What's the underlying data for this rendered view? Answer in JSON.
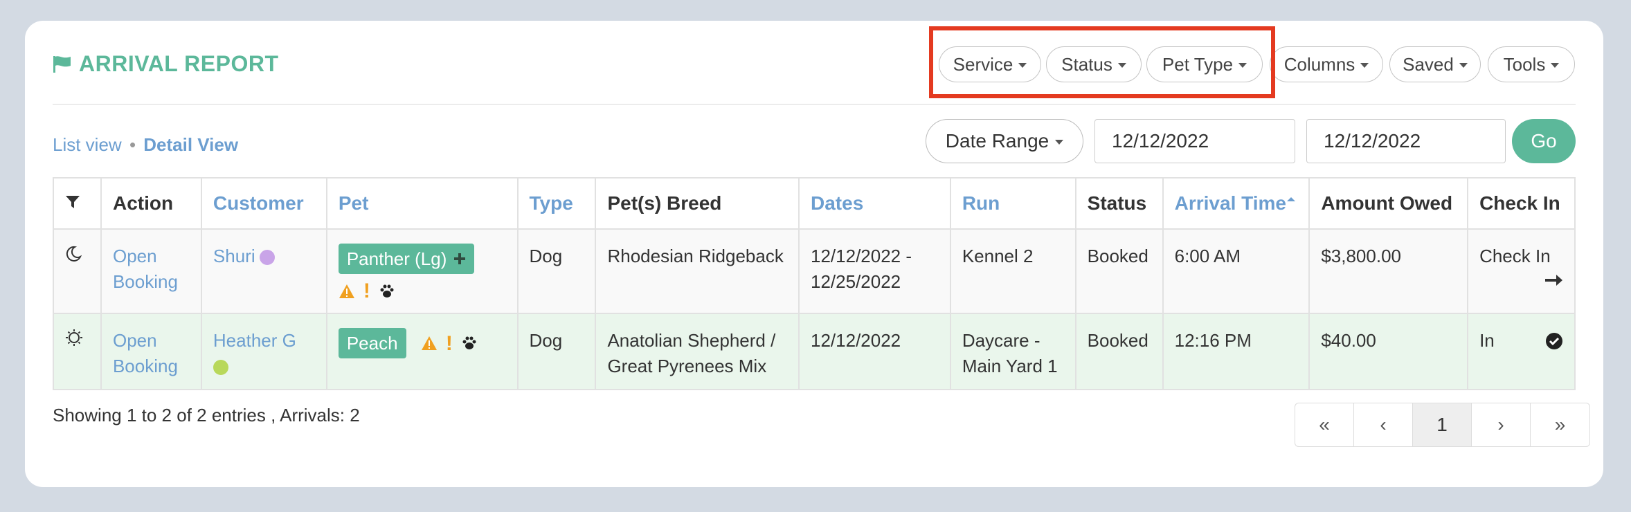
{
  "report": {
    "title": "ARRIVAL REPORT"
  },
  "filters": {
    "service": "Service",
    "status": "Status",
    "pet_type": "Pet Type",
    "columns": "Columns",
    "saved": "Saved",
    "tools": "Tools"
  },
  "views": {
    "list": "List view",
    "separator": "•",
    "detail": "Detail View"
  },
  "date_controls": {
    "range_label": "Date Range",
    "start": "12/12/2022",
    "end": "12/12/2022",
    "go": "Go"
  },
  "table": {
    "headers": {
      "action": "Action",
      "customer": "Customer",
      "pet": "Pet",
      "type": "Type",
      "breed": "Pet(s) Breed",
      "dates": "Dates",
      "run": "Run",
      "status": "Status",
      "arrival": "Arrival Time",
      "owed": "Amount Owed",
      "checkin": "Check In"
    },
    "rows": [
      {
        "action": "Open Booking",
        "customer": "Shuri",
        "customer_dot_color": "#c9a4e8",
        "pet": "Panther (Lg)",
        "type": "Dog",
        "breed": "Rhodesian Ridgeback",
        "dates": "12/12/2022 - 12/25/2022",
        "run": "Kennel 2",
        "status": "Booked",
        "arrival": "6:00 AM",
        "owed": "$3,800.00",
        "checkin": "Check In"
      },
      {
        "action": "Open Booking",
        "customer": "Heather G",
        "customer_dot_color": "#b8d85a",
        "pet": "Peach",
        "type": "Dog",
        "breed": "Anatolian Shepherd / Great Pyrenees Mix",
        "dates": "12/12/2022",
        "run": "Daycare - Main Yard 1",
        "status": "Booked",
        "arrival": "12:16 PM",
        "owed": "$40.00",
        "checkin": "In"
      }
    ]
  },
  "footer": {
    "summary": "Showing 1 to 2 of 2 entries , Arrivals: 2",
    "pages": [
      "«",
      "‹",
      "1",
      "›",
      "»"
    ]
  },
  "colors": {
    "accent": "#5cb89a",
    "link": "#6c9ed0",
    "highlight": "#e43a20"
  }
}
